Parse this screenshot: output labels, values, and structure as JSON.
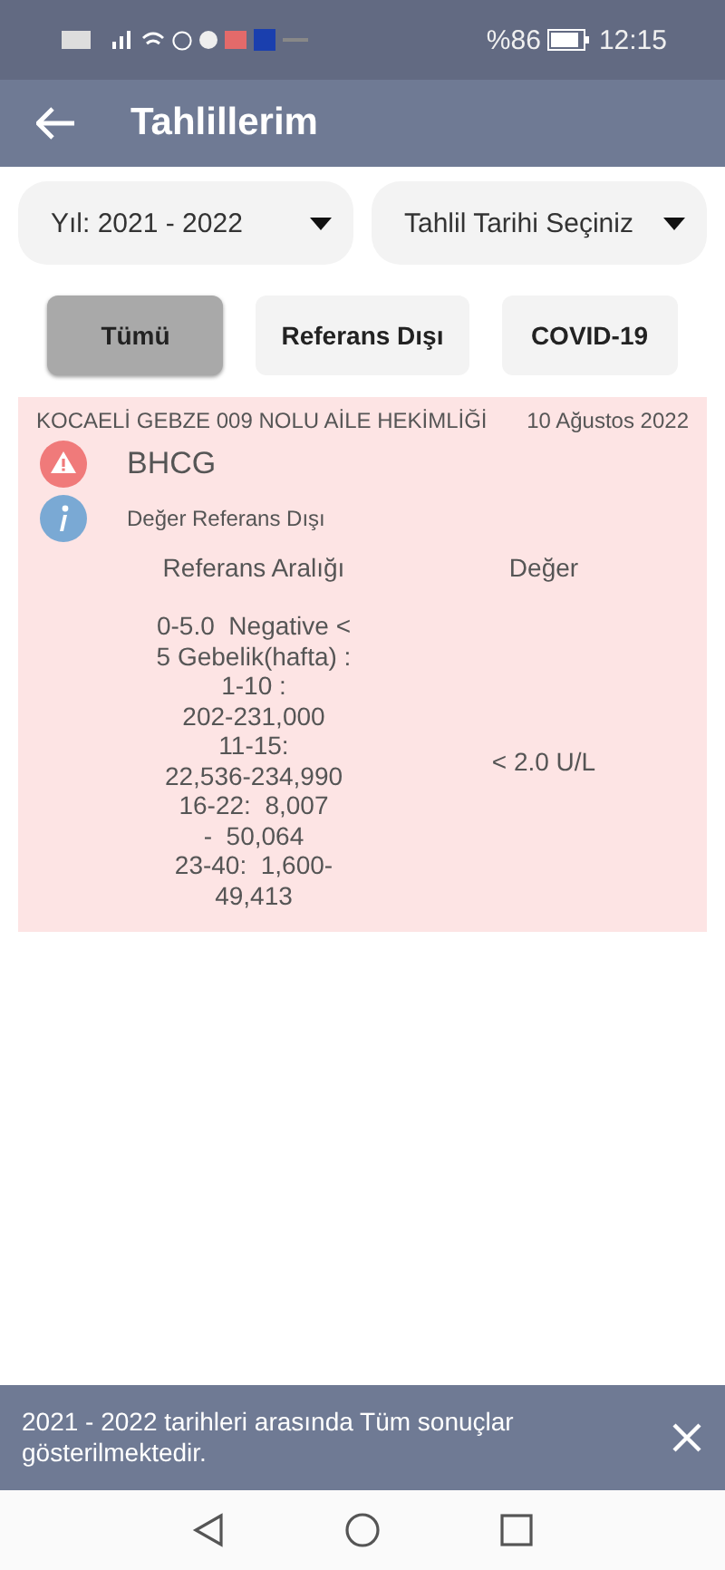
{
  "status_bar": {
    "battery_percent": "%86",
    "time": "12:15"
  },
  "app_bar": {
    "title": "Tahlillerim"
  },
  "filters": [
    {
      "label": "Yıl: 2021 - 2022"
    },
    {
      "label": "Tahlil Tarihi Seçiniz"
    }
  ],
  "chips": [
    {
      "label": "Tümü",
      "selected": true
    },
    {
      "label": "Referans Dışı",
      "selected": false
    },
    {
      "label": "COVID-19",
      "selected": false
    }
  ],
  "results": [
    {
      "institution": "KOCAELİ GEBZE 009 NOLU AİLE HEKİMLİĞİ",
      "date": "10 Ağustos 2022",
      "test": "BHCG",
      "out_of_range": true,
      "note": "Değer Referans Dışı",
      "range_header": "Referans Aralığı",
      "value_header": "Değer",
      "range_lines": [
        "0-5.0  Negative <",
        "5 Gebelik(hafta) :",
        "1-10 :",
        "202-231,000",
        "11-15:",
        "22,536-234,990",
        "16-22:  8,007",
        "-  50,064",
        "23-40:  1,600-",
        "49,413"
      ],
      "value": "< 2.0 U/L"
    }
  ],
  "snackbar": {
    "message": "2021 - 2022 tarihleri arasında Tüm sonuçlar gösterilmektedir."
  }
}
